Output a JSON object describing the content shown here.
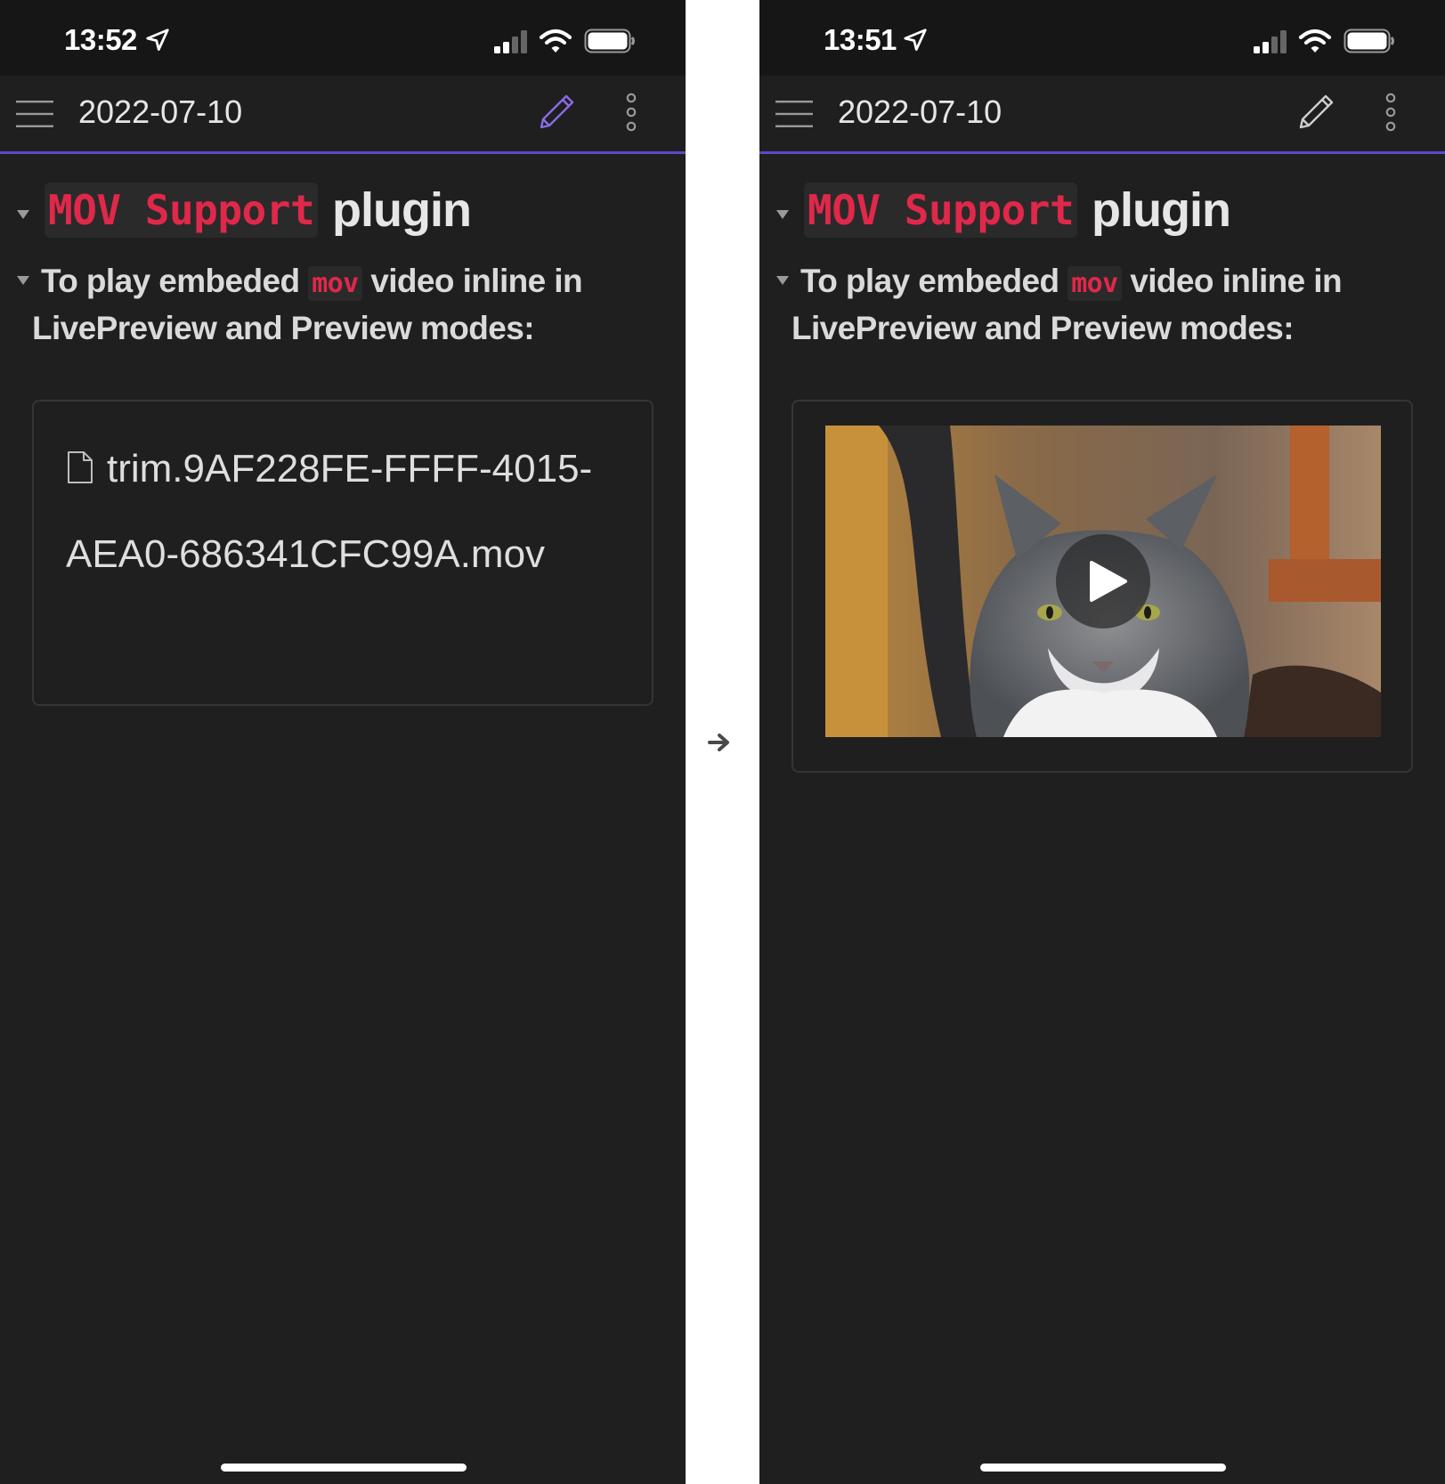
{
  "left": {
    "status": {
      "time": "13:52"
    },
    "appbar": {
      "title": "2022-07-10",
      "pencil_color": "#8b6ce6"
    },
    "heading": {
      "code": "MOV Support",
      "text": "plugin"
    },
    "paragraph": {
      "before": "To play embeded",
      "code": "mov",
      "after": "video inline in LivePreview and Preview modes:"
    },
    "embed": {
      "filename": "trim.9AF228FE-FFFF-4015-AEA0-686341CFC99A.mov"
    }
  },
  "right": {
    "status": {
      "time": "13:51"
    },
    "appbar": {
      "title": "2022-07-10",
      "pencil_color": "#cfcfcf"
    },
    "heading": {
      "code": "MOV Support",
      "text": "plugin"
    },
    "paragraph": {
      "before": "To play embeded",
      "code": "mov",
      "after": "video inline in LivePreview and Preview modes:"
    },
    "embed": {
      "kind": "video"
    }
  },
  "colors": {
    "accent": "#5f47c9",
    "code_text": "#e0284a",
    "background": "#1f1f1f"
  },
  "icons": [
    "location-arrow-icon",
    "signal-icon",
    "wifi-icon",
    "battery-icon",
    "menu-icon",
    "pencil-icon",
    "more-vertical-icon",
    "fold-triangle-icon",
    "file-icon",
    "play-icon",
    "arrow-right-icon"
  ]
}
